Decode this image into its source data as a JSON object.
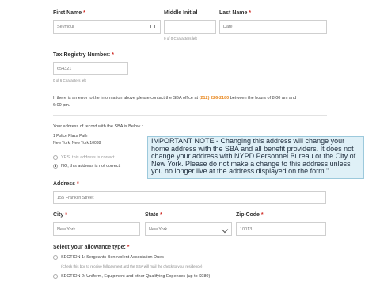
{
  "name_section": {
    "first_name_label": "First Name",
    "first_name_value": "Seymour",
    "middle_initial_label": "Middle Initial",
    "middle_initial_value": "",
    "middle_initial_counter": "0 of 0 Characters left",
    "last_name_label": "Last Name",
    "last_name_value": "Date",
    "required_mark": "*"
  },
  "tax": {
    "label": "Tax Registry Number:",
    "value": "654321",
    "counter": "0 of 6 Characters left"
  },
  "error_notice": {
    "prefix": "If there is an error to the information above please contact the SBA office at",
    "phone": "(212) 226-2180",
    "suffix": "between the hours of 8:00 am and",
    "line2": "6:00 pm."
  },
  "address_record": {
    "label": "Your address of record with the SBA is Below :",
    "line1": "1 Police Plaza Path",
    "line2": "New York, New York 10038",
    "option_yes": "YES, this address is correct.",
    "option_no": "NO, this address is not correct.",
    "selected": "no"
  },
  "note": {
    "text": "IMPORTANT NOTE - Changing this address will change your home address with the SBA and all benefit providers. It does not change your address with NYPD Personnel Bureau or the City of New York. Please do not make a change to this address unless you no longer live at the address displayed on the form.\""
  },
  "address_form": {
    "address_label": "Address",
    "address_value": "155 Franklin Street",
    "city_label": "City",
    "city_value": "New York",
    "state_label": "State",
    "state_value": "New York",
    "zip_label": "Zip Code",
    "zip_value": "10013"
  },
  "allowance": {
    "label": "Select your allowance type:",
    "section1": "SECTION 1: Sergeants Benevolent Association Dues",
    "section1_note": "(Check this box to receive full payment and the SBA will mail the check to your residence)",
    "section2": "SECTION 2: Uniform, Equipment and other Qualifying Expenses (up to $980)"
  }
}
